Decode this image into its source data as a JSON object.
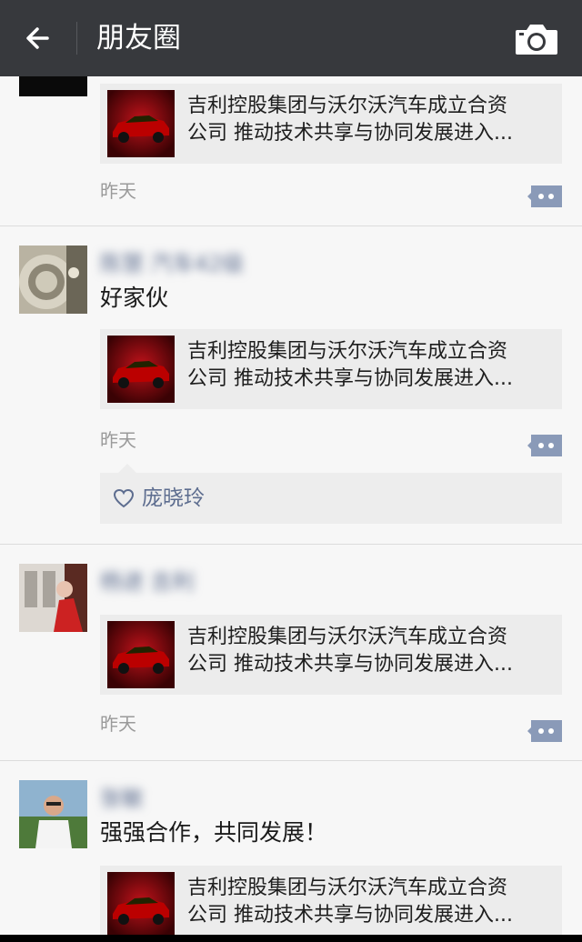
{
  "header": {
    "title": "朋友圈",
    "back_icon": "arrow-left-icon",
    "camera_icon": "camera-icon"
  },
  "posts": [
    {
      "user_name": "",
      "text": "",
      "card": {
        "title_line1": "吉利控股集团与沃尔沃汽车成立合资",
        "title_line2": "公司 推动技术共享与协同发展进入..."
      },
      "time": "昨天",
      "likes": []
    },
    {
      "user_name": "陈慧 汽车42级",
      "text": "好家伙",
      "card": {
        "title_line1": "吉利控股集团与沃尔沃汽车成立合资",
        "title_line2": "公司 推动技术共享与协同发展进入..."
      },
      "time": "昨天",
      "likes": [
        "庞晓玲"
      ]
    },
    {
      "user_name": "杨进 吉利",
      "text": "",
      "card": {
        "title_line1": "吉利控股集团与沃尔沃汽车成立合资",
        "title_line2": "公司 推动技术共享与协同发展进入..."
      },
      "time": "昨天",
      "likes": []
    },
    {
      "user_name": "张敏",
      "text": "强强合作，共同发展！",
      "card": {
        "title_line1": "吉利控股集团与沃尔沃汽车成立合资",
        "title_line2": "公司 推动技术共享与协同发展进入..."
      },
      "time": "",
      "likes": []
    }
  ],
  "colors": {
    "topbar": "#37393d",
    "name_link": "#5d6d8f",
    "comment_button": "#8a9ab8"
  }
}
